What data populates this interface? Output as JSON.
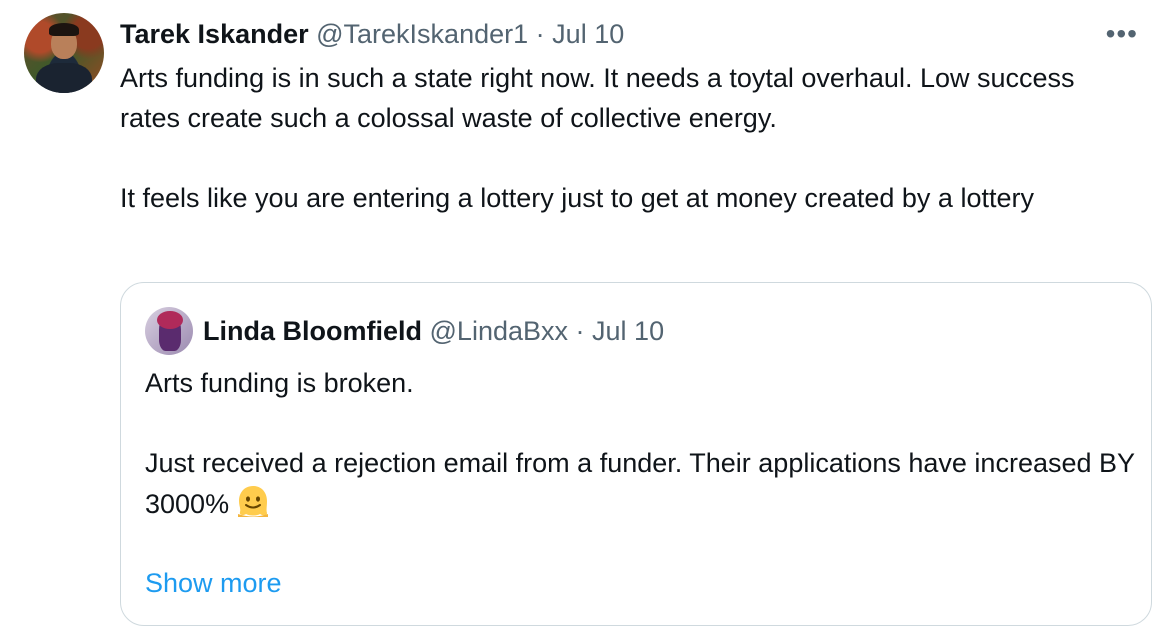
{
  "tweet": {
    "author_name": "Tarek Iskander",
    "author_handle": "@TarekIskander1",
    "separator": "·",
    "date": "Jul 10",
    "more_icon": "more-horizontal-icon",
    "more_label": "•••",
    "text_lines": [
      "Arts funding is in such a state right now. It needs a toytal overhaul. Low success rates create such a colossal waste of collective energy.",
      "It feels like you are entering a lottery just to get at money created by a lottery"
    ]
  },
  "quote": {
    "author_name": "Linda Bloomfield",
    "author_handle": "@LindaBxx",
    "separator": "·",
    "date": "Jul 10",
    "text_lines": [
      "Arts funding is broken.",
      "Just received a rejection email from a funder. Their applications have increased BY 3000%"
    ],
    "emoji_icon": "melting-face-icon",
    "show_more_label": "Show more"
  },
  "colors": {
    "text": "#0f1419",
    "muted": "#536471",
    "link": "#1d9bf0",
    "border": "#cfd9de"
  }
}
